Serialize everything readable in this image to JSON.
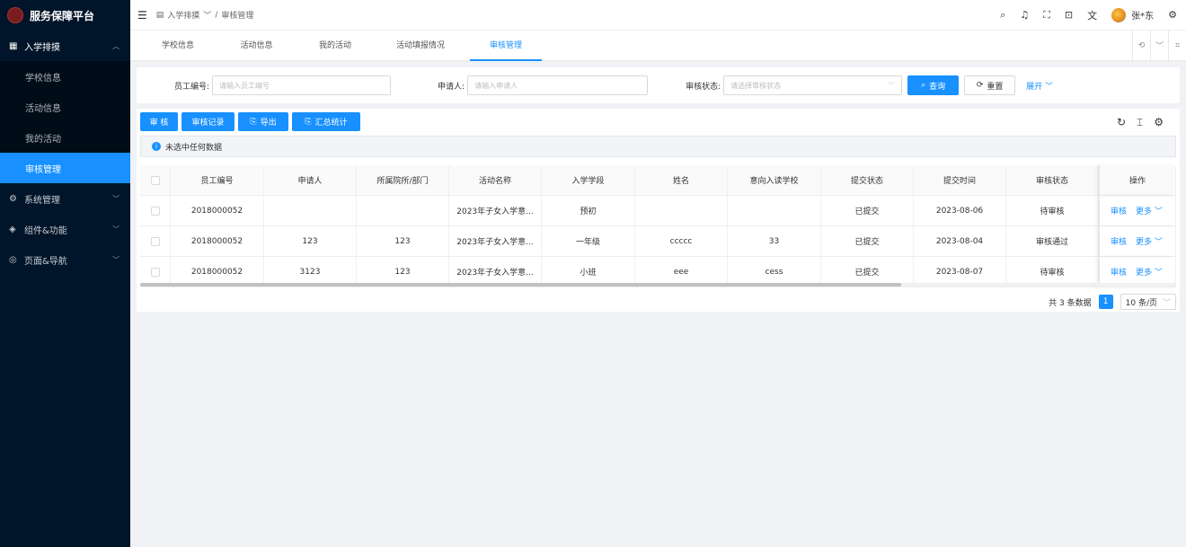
{
  "app": {
    "title": "服务保障平台"
  },
  "sidebar": {
    "groups": [
      {
        "label": "入学排摸",
        "icon": "table-icon",
        "open": true
      },
      {
        "label": "系统管理",
        "icon": "gear-icon"
      },
      {
        "label": "组件&功能",
        "icon": "layers-icon"
      },
      {
        "label": "页面&导航",
        "icon": "compass-icon"
      }
    ],
    "sub_items": [
      "学校信息",
      "活动信息",
      "我的活动",
      "审核管理"
    ],
    "active_item": "审核管理"
  },
  "header": {
    "breadcrumb": [
      "入学排摸",
      "审核管理"
    ],
    "breadcrumb_sep": "/",
    "username": "张*东",
    "icons": [
      "search-icon",
      "bell-icon",
      "fullscreen-icon",
      "lock-icon",
      "translate-icon",
      "settings-icon"
    ]
  },
  "tabs": [
    "学校信息",
    "活动信息",
    "我的活动",
    "活动填报情况",
    "审核管理"
  ],
  "active_tab": "审核管理",
  "search": {
    "employee_label": "员工编号:",
    "employee_placeholder": "请输入员工编号",
    "applicant_label": "申请人:",
    "applicant_placeholder": "请输入申请人",
    "status_label": "审核状态:",
    "status_placeholder": "请选择审核状态",
    "query_label": "查询",
    "reset_label": "重置",
    "expand_label": "展开"
  },
  "toolbar": {
    "review_label": "审 核",
    "records_label": "审核记录",
    "export_label": "导出",
    "summary_label": "汇总统计"
  },
  "alert": {
    "text": "未选中任何数据"
  },
  "table": {
    "columns": [
      "员工编号",
      "申请人",
      "所属院所/部门",
      "活动名称",
      "入学学段",
      "姓名",
      "意向入读学校",
      "提交状态",
      "提交时间",
      "审核状态",
      "操作"
    ],
    "rows": [
      {
        "emp": "2018000052",
        "applicant": "",
        "dept": "",
        "activity": "2023年子女入学意...",
        "stage": "预初",
        "name": "",
        "school": "",
        "submit_status": "已提交",
        "submit_time": "2023-08-06",
        "review_status": "待审核"
      },
      {
        "emp": "2018000052",
        "applicant": "123",
        "dept": "123",
        "activity": "2023年子女入学意...",
        "stage": "一年级",
        "name": "ccccc",
        "school": "33",
        "submit_status": "已提交",
        "submit_time": "2023-08-04",
        "review_status": "审核通过"
      },
      {
        "emp": "2018000052",
        "applicant": "3123",
        "dept": "123",
        "activity": "2023年子女入学意...",
        "stage": "小班",
        "name": "eee",
        "school": "cess",
        "submit_status": "已提交",
        "submit_time": "2023-08-07",
        "review_status": "待审核"
      }
    ],
    "op_review": "审核",
    "op_more": "更多"
  },
  "pager": {
    "total_text": "共 3 条数据",
    "current_page": "1",
    "page_size": "10 条/页"
  },
  "colors": {
    "primary": "#1890ff",
    "sidebar_bg": "#001529"
  }
}
